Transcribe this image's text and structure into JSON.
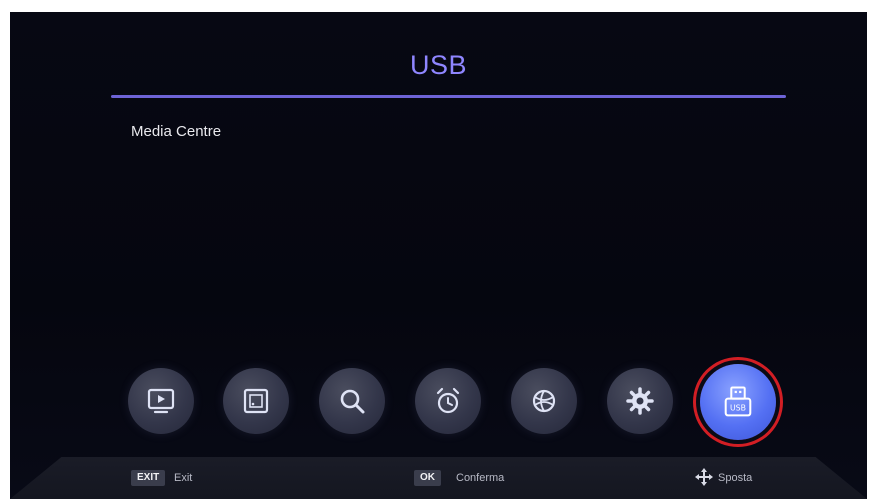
{
  "header": {
    "title": "USB"
  },
  "menu": {
    "items": [
      {
        "label": "Media Centre"
      }
    ]
  },
  "dock": {
    "icons": [
      {
        "name": "tv-play-icon"
      },
      {
        "name": "picture-frame-icon"
      },
      {
        "name": "search-icon"
      },
      {
        "name": "alarm-clock-icon"
      },
      {
        "name": "globe-icon"
      },
      {
        "name": "gear-icon"
      },
      {
        "name": "usb-drive-icon",
        "label": "USB",
        "selected": true
      }
    ]
  },
  "footer": {
    "exit_key": "EXIT",
    "exit_label": "Exit",
    "ok_key": "OK",
    "ok_label": "Conferma",
    "move_label": "Sposta",
    "move_icon": "move-arrows-icon"
  },
  "colors": {
    "accent": "#8f86ff",
    "selected_button": "#5470f3",
    "selection_ring": "#d21e24",
    "background": "#05060f"
  }
}
